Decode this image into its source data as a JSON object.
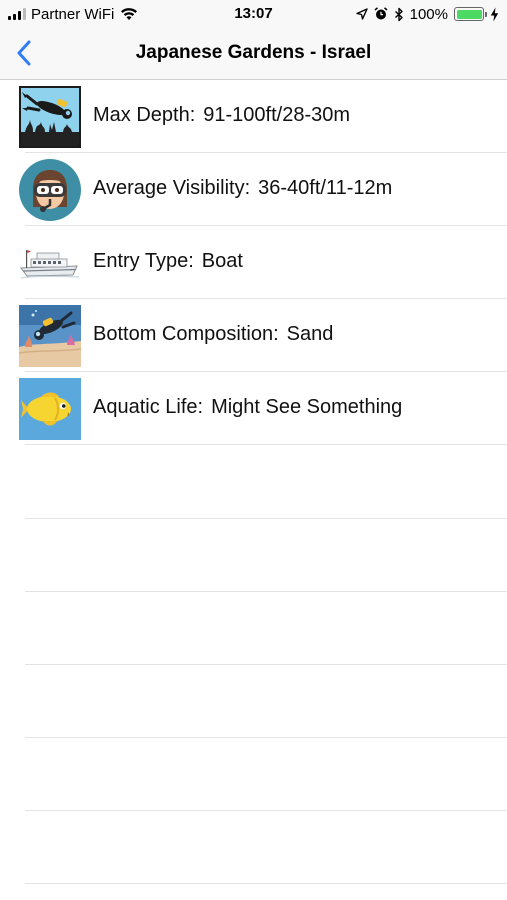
{
  "status_bar": {
    "carrier": "Partner WiFi",
    "time": "13:07",
    "battery_percent": "100%",
    "battery_level": 1.0
  },
  "nav": {
    "title": "Japanese Gardens - Israel",
    "back_icon": "chevron-left-icon"
  },
  "rows": [
    {
      "label": "Max Depth:",
      "value": "91-100ft/28-30m",
      "icon": "diver-depth-icon"
    },
    {
      "label": "Average Visibility:",
      "value": "36-40ft/11-12m",
      "icon": "diver-mask-icon"
    },
    {
      "label": "Entry Type:",
      "value": "Boat",
      "icon": "boat-icon"
    },
    {
      "label": "Bottom Composition:",
      "value": "Sand",
      "icon": "diver-sand-icon"
    },
    {
      "label": "Aquatic Life:",
      "value": "Might See Something",
      "icon": "fish-icon"
    }
  ],
  "colors": {
    "accent": "#2f7cf6",
    "battery": "#4cd964",
    "separator": "#e3e3e6"
  }
}
